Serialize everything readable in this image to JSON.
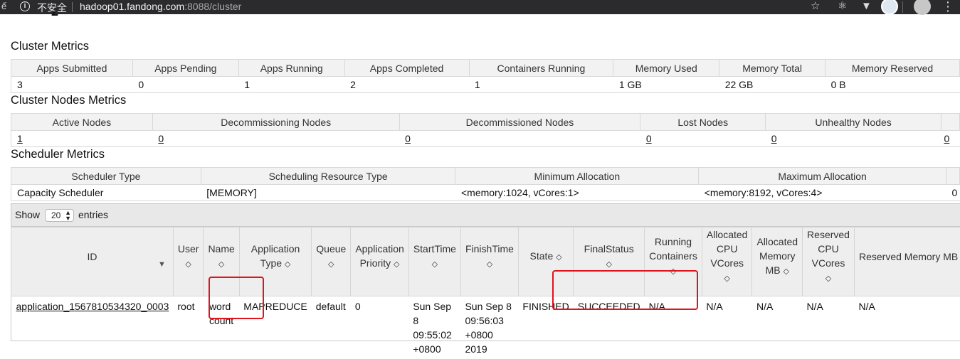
{
  "browser": {
    "edge_glyph": "ế",
    "info_icon": "i",
    "security_label": "不安全",
    "url_host": "hadoop01.fandong.com",
    "url_rest": ":8088/cluster"
  },
  "partial_glyph": "2",
  "cluster_metrics": {
    "title": "Cluster Metrics",
    "headers": [
      "Apps Submitted",
      "Apps Pending",
      "Apps Running",
      "Apps Completed",
      "Containers Running",
      "Memory Used",
      "Memory Total",
      "Memory Reserved"
    ],
    "values": [
      "3",
      "0",
      "1",
      "2",
      "1",
      "1 GB",
      "22 GB",
      "0 B"
    ]
  },
  "node_metrics": {
    "title": "Cluster Nodes Metrics",
    "headers": [
      "Active Nodes",
      "Decommissioning Nodes",
      "Decommissioned Nodes",
      "Lost Nodes",
      "Unhealthy Nodes"
    ],
    "values": [
      "1",
      "0",
      "0",
      "0",
      "0",
      "0"
    ]
  },
  "scheduler_metrics": {
    "title": "Scheduler Metrics",
    "headers": [
      "Scheduler Type",
      "Scheduling Resource Type",
      "Minimum Allocation",
      "Maximum Allocation"
    ],
    "values": [
      "Capacity Scheduler",
      "[MEMORY]",
      "<memory:1024, vCores:1>",
      "<memory:8192, vCores:4>",
      "0"
    ]
  },
  "apps_table": {
    "show_label": "Show",
    "entries_label": "entries",
    "page_size": "20",
    "headers": [
      "ID",
      "User",
      "Name",
      "Application Type",
      "Queue",
      "Application Priority",
      "StartTime",
      "FinishTime",
      "State",
      "FinalStatus",
      "Running Containers",
      "Allocated CPU VCores",
      "Allocated Memory MB",
      "Reserved CPU VCores",
      "Reserved Memory MB"
    ],
    "row": {
      "id": "application_1567810534320_0003",
      "user": "root",
      "name": "word count",
      "type": "MAPREDUCE",
      "queue": "default",
      "priority": "0",
      "start": "Sun Sep 8 09:55:02 +0800",
      "finish": "Sun Sep 8 09:56:03 +0800 2019",
      "state": "FINISHED",
      "final_status": "SUCCEEDED",
      "running_containers": "N/A",
      "alloc_cpu": "N/A",
      "alloc_mem": "N/A",
      "reserved_cpu": "N/A",
      "reserved_mem": "N/A"
    }
  }
}
